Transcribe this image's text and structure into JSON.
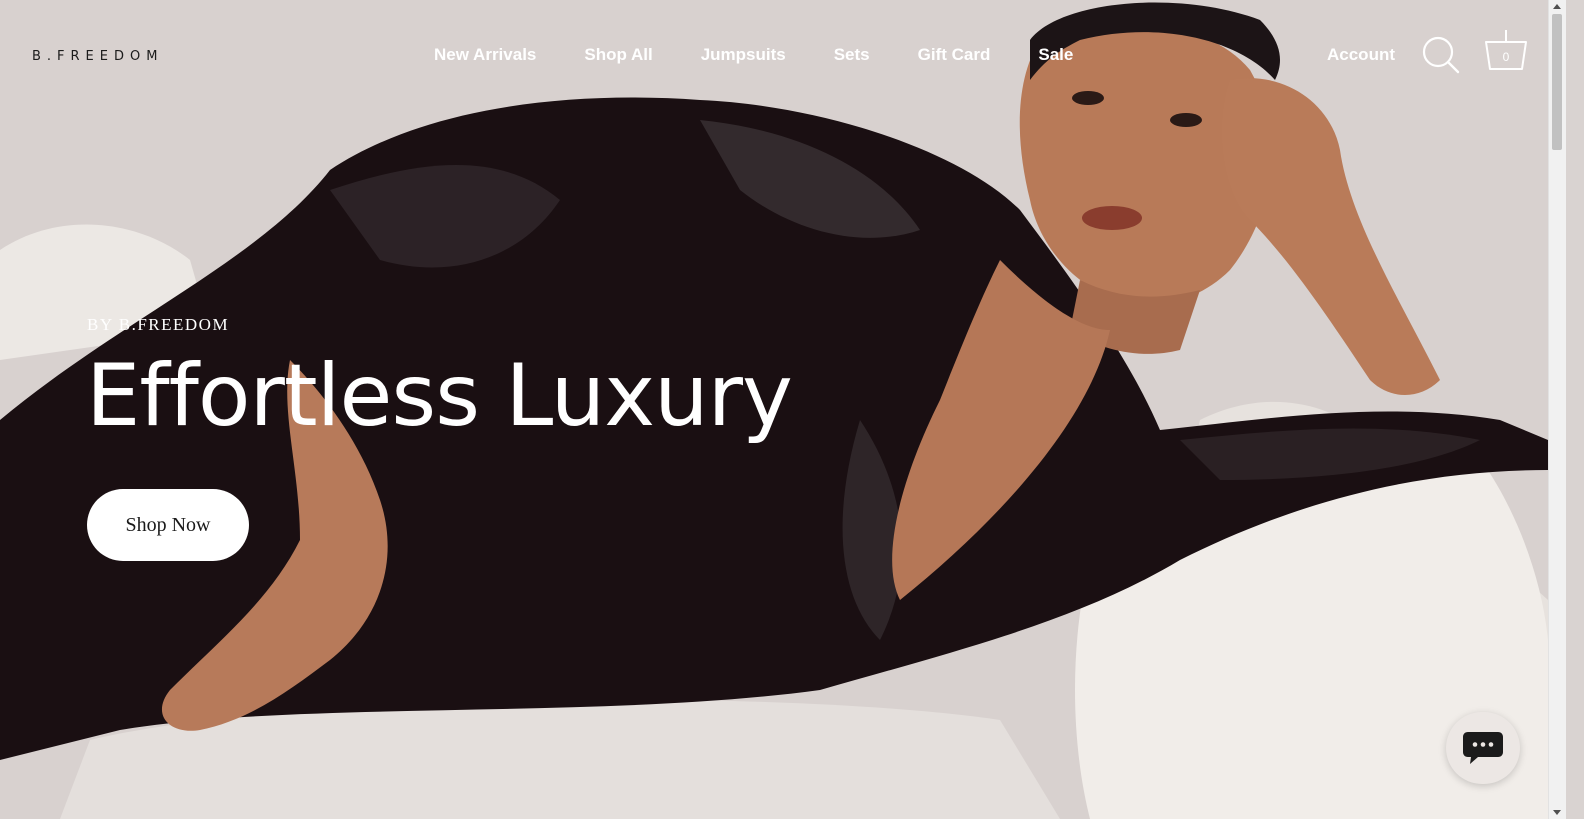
{
  "header": {
    "logo": "B.FREEDOM",
    "nav": [
      {
        "label": "New Arrivals"
      },
      {
        "label": "Shop All"
      },
      {
        "label": "Jumpsuits"
      },
      {
        "label": "Sets"
      },
      {
        "label": "Gift Card"
      },
      {
        "label": "Sale"
      }
    ],
    "account_label": "Account",
    "search_icon": "search-icon",
    "cart_icon": "basket-icon",
    "cart_count": "0"
  },
  "hero": {
    "eyebrow": "BY B.FREEDOM",
    "title": "Effortless Luxury",
    "cta_label": "Shop Now"
  },
  "chat": {
    "icon": "chat-bubble-icon"
  },
  "colors": {
    "nav_text": "#ffffff",
    "logo_text": "#1b1b1b",
    "cta_bg": "#ffffff",
    "cta_text": "#1a1a1a",
    "chat_bg": "#ece7e4"
  }
}
